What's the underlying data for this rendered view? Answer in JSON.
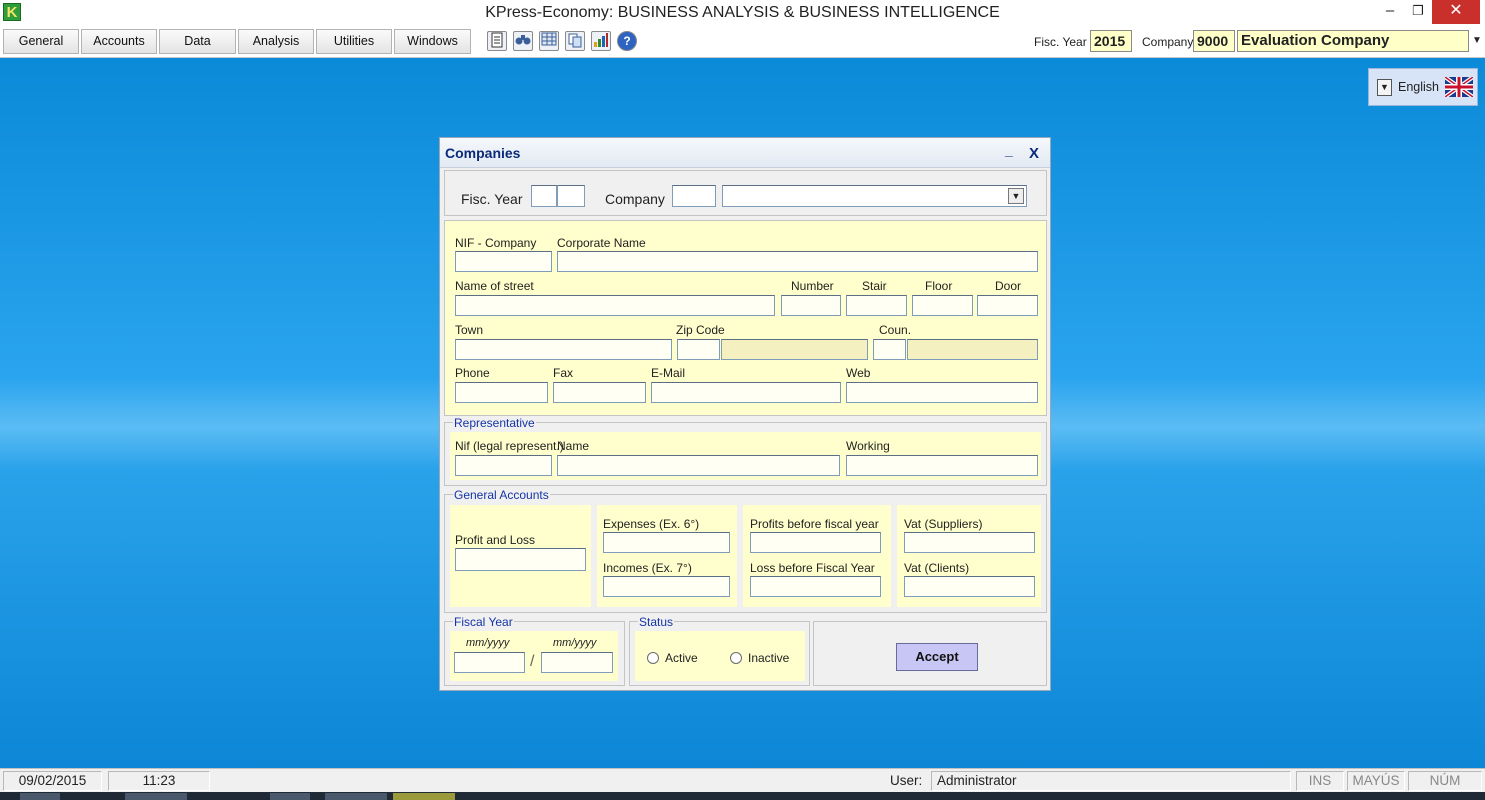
{
  "app": {
    "logo": "K",
    "title": "KPress-Economy: BUSINESS ANALYSIS & BUSINESS INTELLIGENCE",
    "window_controls": {
      "minimize": "–",
      "restore": "❐",
      "close": "✕"
    }
  },
  "menu": {
    "items": [
      "General",
      "Accounts",
      "Data",
      "Analysis",
      "Utilities",
      "Windows"
    ],
    "toolbar_icons": [
      "document-icon",
      "binoculars-icon",
      "calculator-icon",
      "copy-icon",
      "bar-chart-icon",
      "help-icon"
    ],
    "fisc_year_label": "Fisc. Year",
    "fisc_year_value": "2015",
    "company_label": "Company",
    "company_code": "9000",
    "company_name": "Evaluation Company"
  },
  "language": {
    "label": "English"
  },
  "dialog": {
    "title": "Companies",
    "min": "_",
    "close": "X",
    "filter": {
      "fisc_year_label": "Fisc. Year",
      "company_label": "Company"
    },
    "company": {
      "nif_label": "NIF - Company",
      "corporate_name_label": "Corporate Name",
      "street_label": "Name of street",
      "number_label": "Number",
      "stair_label": "Stair",
      "floor_label": "Floor",
      "door_label": "Door",
      "town_label": "Town",
      "zip_label": "Zip Code",
      "country_label": "Coun.",
      "phone_label": "Phone",
      "fax_label": "Fax",
      "email_label": "E-Mail",
      "web_label": "Web"
    },
    "representative": {
      "group_title": "Representative",
      "nif_label": "Nif (legal represent.)",
      "name_label": "Name",
      "working_label": "Working"
    },
    "accounts": {
      "group_title": "General Accounts",
      "profit_loss_label": "Profit and Loss",
      "expenses_label": "Expenses (Ex. 6°)",
      "incomes_label": "Incomes (Ex. 7°)",
      "profits_before_label": "Profits before fiscal year",
      "loss_before_label": "Loss before Fiscal Year",
      "vat_suppliers_label": "Vat (Suppliers)",
      "vat_clients_label": "Vat (Clients)"
    },
    "fiscal_year": {
      "group_title": "Fiscal Year",
      "start_hint": "mm/yyyy",
      "end_hint": "mm/yyyy",
      "separator": "/"
    },
    "status": {
      "group_title": "Status",
      "active_label": "Active",
      "inactive_label": "Inactive"
    },
    "accept_label": "Accept"
  },
  "statusbar": {
    "date": "09/02/2015",
    "time": "11:23",
    "user_label": "User:",
    "user_value": "Administrator",
    "ins": "INS",
    "mayus": "MAYÚS",
    "num": "NÚM"
  }
}
